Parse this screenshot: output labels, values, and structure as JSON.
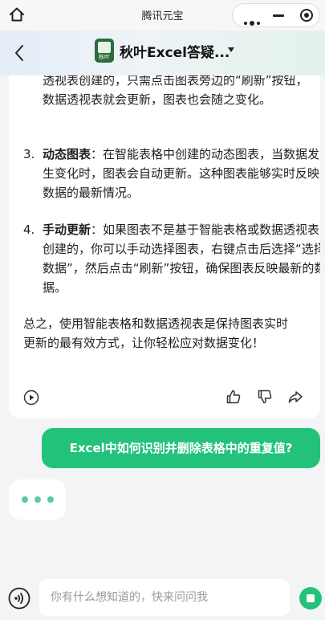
{
  "mini_program": {
    "title": "腾讯元宝"
  },
  "header": {
    "title": "秋叶Excel答疑...",
    "app_icon_label": "秋叶"
  },
  "answer": {
    "item1_tail": "透视表创建的，只需点击图表旁边的“刷新”按钮，数据透视表就会更新，图表也会随之变化。",
    "items": [
      {
        "num": "3.",
        "bold": "动态图表",
        "text": "：在智能表格中创建的动态图表，当数据发生变化时，图表会自动更新。这种图表能够实时反映数据的最新情况。"
      },
      {
        "num": "4.",
        "bold": "手动更新",
        "text": "：如果图表不是基于智能表格或数据透视表创建的，你可以手动选择图表，右键点击后选择“选择数据”，然后点击“刷新”按钮，确保图表反映最新的数据。"
      }
    ],
    "summary": "总之，使用智能表格和数据透视表是保持图表实时更新的最有效方式，让你轻松应对数据变化！"
  },
  "user_message": "Excel中如何识别并删除表格中的重复值?",
  "input": {
    "placeholder": "你有什么想知道的，快来问问我"
  },
  "icons": {
    "home": "home-icon",
    "more": "more-dots-icon",
    "minimize": "minimize-icon",
    "close": "record-close-icon",
    "back": "chevron-left-icon",
    "play": "play-icon",
    "like": "thumbs-up-icon",
    "dislike": "thumbs-down-icon",
    "share": "share-icon",
    "voice": "voice-icon",
    "stop": "stop-icon"
  },
  "colors": {
    "accent": "#23c27b",
    "typing_dot": "#5fc9a2"
  }
}
